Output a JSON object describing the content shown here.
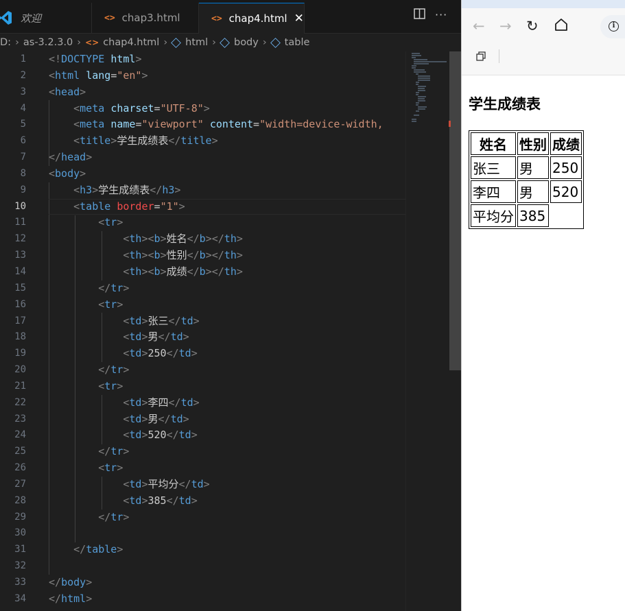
{
  "editor": {
    "tabs": [
      {
        "label": "欢迎",
        "icon": "vscode-logo-icon"
      },
      {
        "label": "chap3.html",
        "icon": "html-file-icon"
      },
      {
        "label": "chap4.html",
        "icon": "html-file-icon",
        "active": true
      }
    ],
    "tab_close_glyph": "✕",
    "breadcrumb": [
      "D:",
      "as-3.2.3.0",
      "chap4.html",
      "html",
      "body",
      "table"
    ],
    "active_line": 10,
    "line_numbers": [
      "1",
      "2",
      "3",
      "4",
      "5",
      "6",
      "7",
      "8",
      "9",
      "10",
      "11",
      "12",
      "13",
      "14",
      "15",
      "16",
      "17",
      "18",
      "19",
      "20",
      "21",
      "22",
      "23",
      "24",
      "25",
      "26",
      "27",
      "28",
      "29",
      "30",
      "31",
      "32",
      "33",
      "34"
    ],
    "code": {
      "l4_charset": "\"UTF-8\"",
      "l5_name": "\"viewport\"",
      "l5_content": "\"width=device-width,",
      "l6_title": "学生成绩表",
      "l9_h3": "学生成绩表",
      "l10_border": "\"1\"",
      "l12": "姓名",
      "l13": "性别",
      "l14": "成绩",
      "l17": "张三",
      "l18": "男",
      "l19": "250",
      "l22": "李四",
      "l23": "男",
      "l24": "520",
      "l27": "平均分",
      "l28": "385",
      "l2_lang": "\"en\""
    }
  },
  "browser": {
    "page_heading": "学生成绩表",
    "table": {
      "headers": [
        "姓名",
        "性别",
        "成绩"
      ],
      "rows": [
        [
          "张三",
          "男",
          "250"
        ],
        [
          "李四",
          "男",
          "520"
        ],
        [
          "平均分",
          "385"
        ]
      ]
    }
  },
  "colors": {
    "editor_bg": "#1f1f1f",
    "tag": "#569cd6",
    "attr": "#9cdcfe",
    "string": "#ce9178",
    "accent": "#0078d4"
  }
}
